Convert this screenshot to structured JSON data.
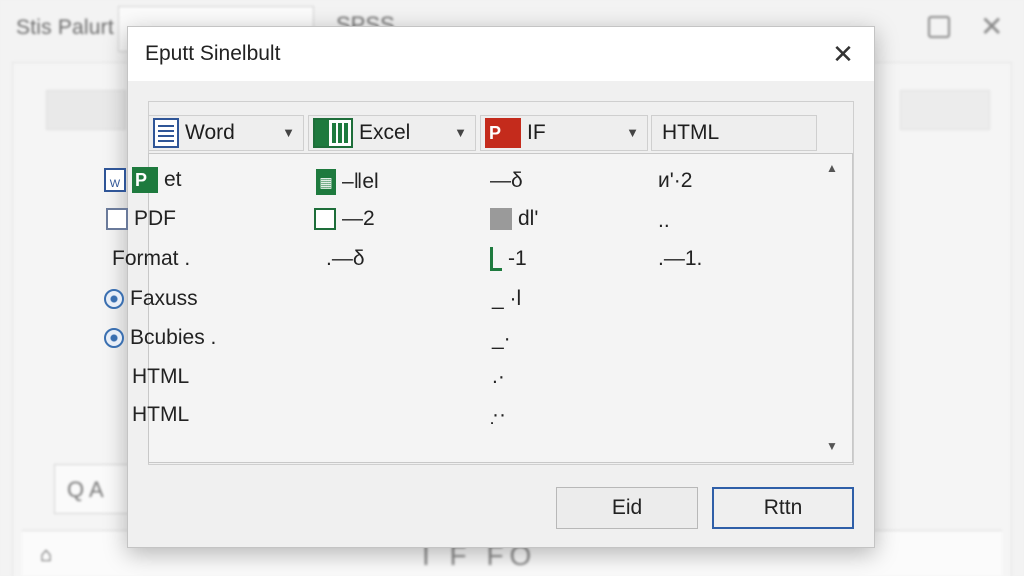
{
  "background": {
    "app_title": "Stis Palurt",
    "combo_chevron": "⌄",
    "document_title": "SPSS",
    "search_box_text": "Q A",
    "bottom_text": "I F FO",
    "home_icon": "home-icon"
  },
  "dialog": {
    "title": "Eputt Sinelbult",
    "close_glyph": "✕",
    "columns": [
      {
        "label": "Word",
        "icon": "word-icon",
        "dropdown": "▼"
      },
      {
        "label": "Excel",
        "icon": "excel-icon",
        "dropdown": "▼"
      },
      {
        "label": "IF",
        "icon": "pdf-icon",
        "icon_text": "P",
        "dropdown": "▼"
      },
      {
        "label": "HTML"
      }
    ],
    "rows": [
      {
        "label": "et",
        "c1": "–‖el",
        "c2": "—δ",
        "c3": "ᴎ'·2",
        "label_icon": "green-p-icon",
        "pre_icon": "word-doc-icon",
        "label_icon_text": "P",
        "pre_icon_text": "W",
        "c1_icon_text": "▦"
      },
      {
        "label": "PDF",
        "c1": "—2",
        "c2": "dl'",
        "c3": "..",
        "label_icon": "square-icon",
        "c1_icon": "green-square-icon",
        "c2_icon": "gray-square-icon"
      },
      {
        "label": "Format .",
        "c1": ".—δ",
        "c2": "-1",
        "c3": ".—1.",
        "c2_icon": "green-bracket-icon"
      },
      {
        "label": "Faxuss",
        "c2": "_ ·l",
        "pre_icon": "radio-icon"
      },
      {
        "label": "Bcubies .",
        "c2": "_·",
        "pre_icon": "radio-icon"
      },
      {
        "label": "HTML",
        "c2": ".·"
      },
      {
        "label": "HTML",
        "c2": "·̣·"
      }
    ],
    "scroll_up": "▲",
    "scroll_down": "▼",
    "buttons": {
      "edit": "Eid",
      "return": "Rttn"
    }
  }
}
